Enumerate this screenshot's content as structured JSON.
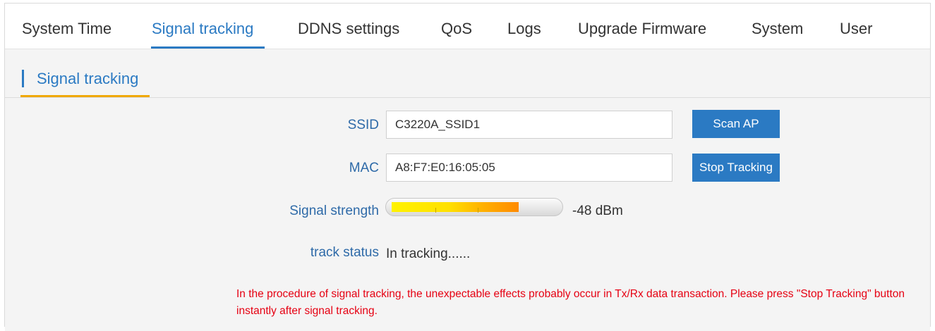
{
  "tabs": [
    {
      "label": "System Time",
      "active": false
    },
    {
      "label": "Signal tracking",
      "active": true
    },
    {
      "label": "DDNS settings",
      "active": false
    },
    {
      "label": "QoS",
      "active": false
    },
    {
      "label": "Logs",
      "active": false
    },
    {
      "label": "Upgrade Firmware",
      "active": false
    },
    {
      "label": "System",
      "active": false
    },
    {
      "label": "User",
      "active": false
    }
  ],
  "section": {
    "title": "Signal tracking"
  },
  "form": {
    "ssid": {
      "label": "SSID",
      "value": "C3220A_SSID1"
    },
    "mac": {
      "label": "MAC",
      "value": "A8:F7:E0:16:05:05"
    },
    "signal_strength": {
      "label": "Signal strength",
      "value_text": "-48 dBm",
      "level_fraction": 0.77
    },
    "track_status": {
      "label": "track status",
      "value": "In tracking......"
    }
  },
  "buttons": {
    "scan_ap": "Scan AP",
    "stop_tracking": "Stop Tracking"
  },
  "warning": "In the procedure of signal tracking, the unexpectable effects probably occur in Tx/Rx data transaction. Please press \"Stop Tracking\" button instantly after signal tracking.",
  "colors": {
    "accent": "#2b7ac3",
    "section_underline": "#f0a800",
    "warning": "#e60012"
  }
}
